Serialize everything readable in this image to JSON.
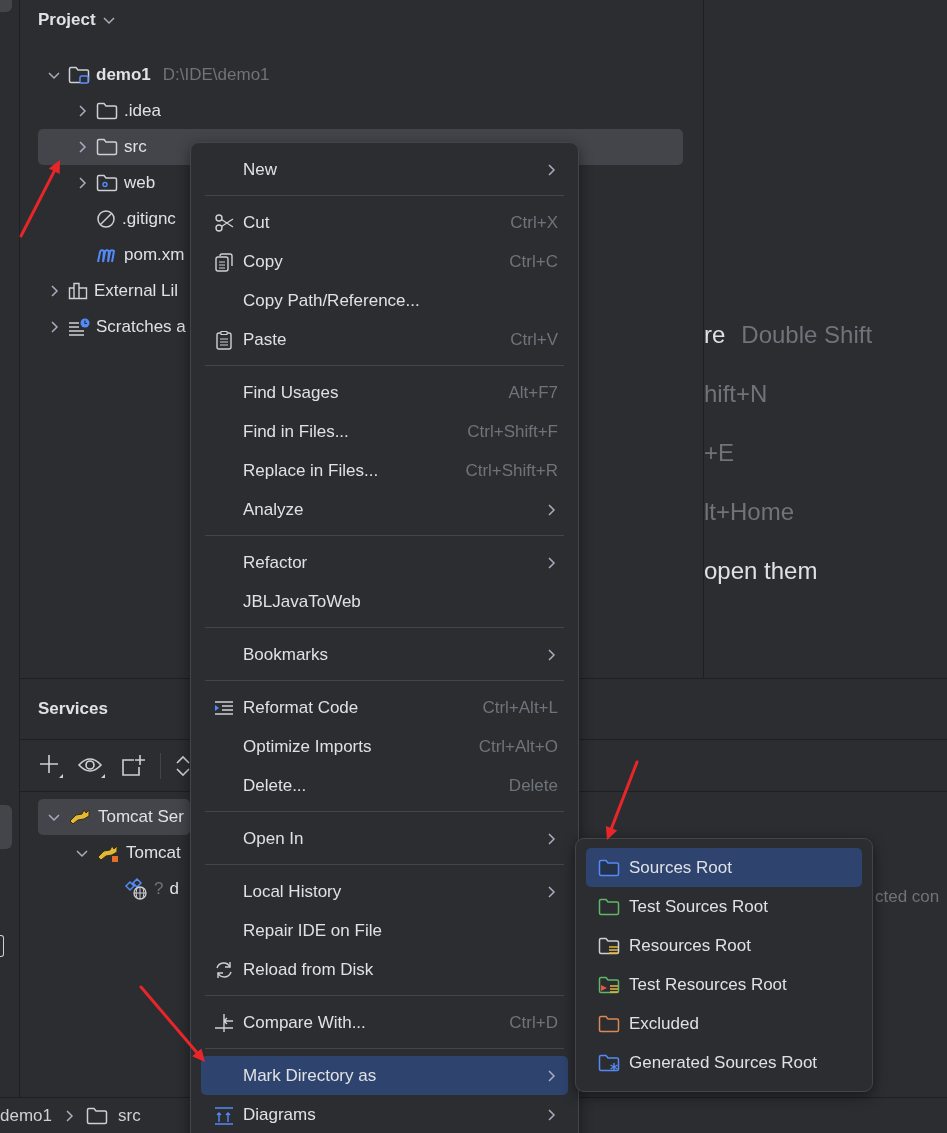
{
  "project_panel": {
    "title": "Project",
    "tree": [
      {
        "label": "demo1",
        "path": "D:\\IDE\\demo1",
        "kind": "module",
        "expanded": true,
        "selected": false,
        "children": [
          {
            "label": ".idea",
            "kind": "folder",
            "expanded": false,
            "selected": false
          },
          {
            "label": "src",
            "kind": "folder",
            "expanded": false,
            "selected": true
          },
          {
            "label": "web",
            "kind": "web-folder",
            "expanded": false,
            "selected": false
          },
          {
            "label": ".gitignc",
            "kind": "ignore-file",
            "selected": false
          },
          {
            "label": "pom.xm",
            "kind": "maven-file",
            "selected": false
          }
        ]
      },
      {
        "label": "External Lil",
        "kind": "libraries",
        "expanded": false,
        "selected": false
      },
      {
        "label": "Scratches a",
        "kind": "scratches",
        "expanded": false,
        "selected": false
      }
    ]
  },
  "editor_hints": [
    {
      "action": "re",
      "shortcut": "Double Shift"
    },
    {
      "shortcut": "hift+N"
    },
    {
      "shortcut": "+E"
    },
    {
      "shortcut": "lt+Home"
    },
    {
      "action": "open them"
    }
  ],
  "services_panel": {
    "title": "Services",
    "detail_text": "cted con",
    "tree": [
      {
        "label": "Tomcat Ser",
        "kind": "server-group",
        "expanded": true,
        "selected": true,
        "children": [
          {
            "label": "Tomcat",
            "kind": "server",
            "expanded": true,
            "selected": false,
            "children": [
              {
                "label": "d",
                "kind": "artifact",
                "status": "?",
                "selected": false
              }
            ]
          }
        ]
      }
    ]
  },
  "status_bar": {
    "breadcrumb": [
      "demo1",
      "src"
    ]
  },
  "context_menu": {
    "groups": [
      [
        {
          "label": "New",
          "submenu": true,
          "selected": false
        }
      ],
      [
        {
          "label": "Cut",
          "shortcut": "Ctrl+X",
          "submenu": false,
          "selected": false
        },
        {
          "label": "Copy",
          "shortcut": "Ctrl+C",
          "submenu": false,
          "selected": false
        },
        {
          "label": "Copy Path/Reference...",
          "submenu": false,
          "selected": false
        },
        {
          "label": "Paste",
          "shortcut": "Ctrl+V",
          "submenu": false,
          "selected": false
        }
      ],
      [
        {
          "label": "Find Usages",
          "shortcut": "Alt+F7",
          "submenu": false,
          "selected": false
        },
        {
          "label": "Find in Files...",
          "shortcut": "Ctrl+Shift+F",
          "submenu": false,
          "selected": false
        },
        {
          "label": "Replace in Files...",
          "shortcut": "Ctrl+Shift+R",
          "submenu": false,
          "selected": false
        },
        {
          "label": "Analyze",
          "submenu": true,
          "selected": false
        }
      ],
      [
        {
          "label": "Refactor",
          "submenu": true,
          "selected": false
        },
        {
          "label": "JBLJavaToWeb",
          "submenu": false,
          "selected": false
        }
      ],
      [
        {
          "label": "Bookmarks",
          "submenu": true,
          "selected": false
        }
      ],
      [
        {
          "label": "Reformat Code",
          "shortcut": "Ctrl+Alt+L",
          "submenu": false,
          "selected": false
        },
        {
          "label": "Optimize Imports",
          "shortcut": "Ctrl+Alt+O",
          "submenu": false,
          "selected": false
        },
        {
          "label": "Delete...",
          "shortcut": "Delete",
          "submenu": false,
          "selected": false
        }
      ],
      [
        {
          "label": "Open In",
          "submenu": true,
          "selected": false
        }
      ],
      [
        {
          "label": "Local History",
          "submenu": true,
          "selected": false
        },
        {
          "label": "Repair IDE on File",
          "submenu": false,
          "selected": false
        },
        {
          "label": "Reload from Disk",
          "submenu": false,
          "selected": false
        }
      ],
      [
        {
          "label": "Compare With...",
          "shortcut": "Ctrl+D",
          "submenu": false,
          "selected": false
        }
      ],
      [
        {
          "label": "Mark Directory as",
          "submenu": true,
          "selected": true
        },
        {
          "label": "Diagrams",
          "submenu": true,
          "selected": false
        }
      ]
    ]
  },
  "mark_directory_submenu": {
    "items": [
      {
        "label": "Sources Root",
        "color": "#548af7",
        "selected": true
      },
      {
        "label": "Test Sources Root",
        "color": "#5fb865",
        "selected": false
      },
      {
        "label": "Resources Root",
        "color": "#ced0d6",
        "selected": false
      },
      {
        "label": "Test Resources Root",
        "color": "#5fb865",
        "selected": false
      },
      {
        "label": "Excluded",
        "color": "#d98953",
        "selected": false
      },
      {
        "label": "Generated Sources Root",
        "color": "#548af7",
        "selected": false
      }
    ]
  }
}
